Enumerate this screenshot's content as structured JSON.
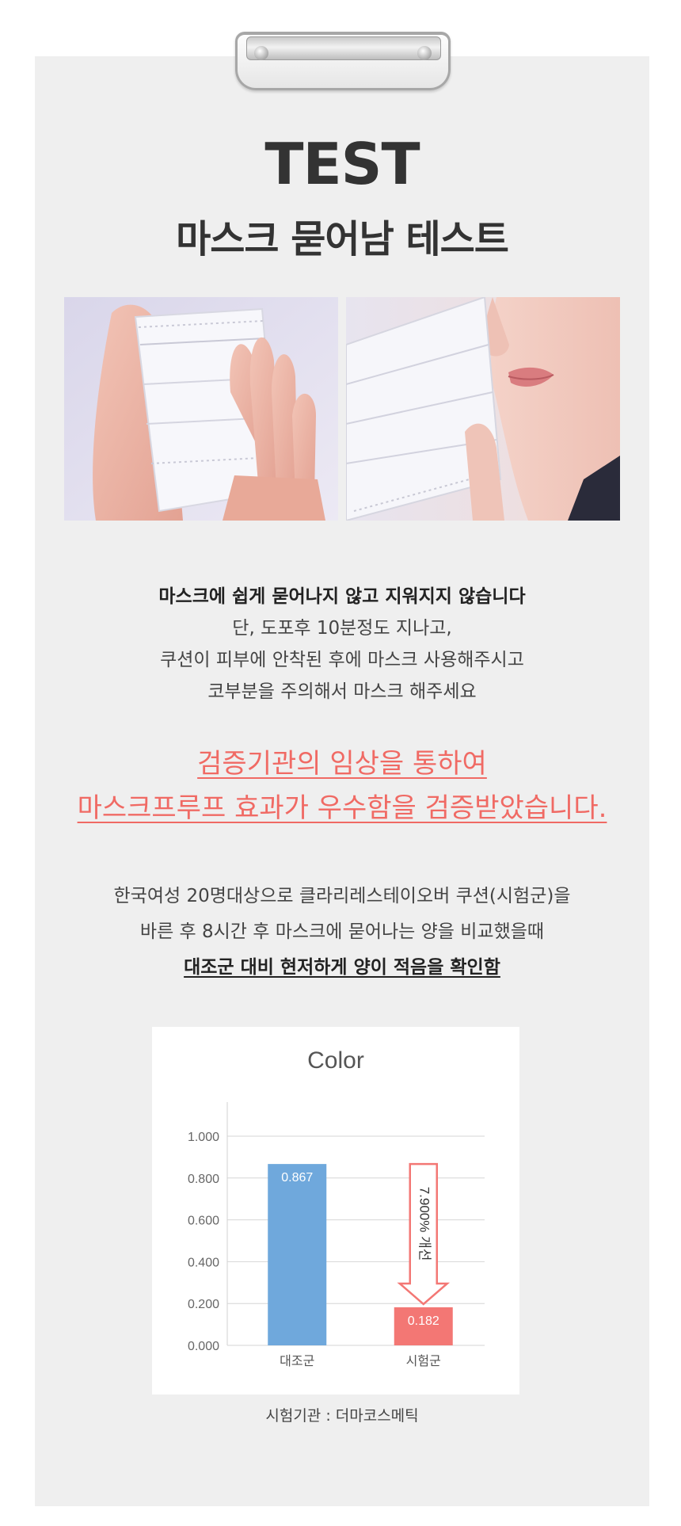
{
  "header": {
    "title_en": "TEST",
    "title_ko": "마스크 묻어남 테스트"
  },
  "photos": [
    {
      "icon": "hand-holding-mask-photo"
    },
    {
      "icon": "mask-near-face-photo"
    }
  ],
  "description": {
    "lead": "마스크에 쉽게 묻어나지 않고 지워지지 않습니다",
    "lines": [
      "단, 도포후 10분정도 지나고,",
      "쿠션이 피부에 안착된 후에 마스크 사용해주시고",
      "코부분을 주의해서 마스크 해주세요"
    ]
  },
  "headline": {
    "line1": "검증기관의 임상을 통하여",
    "line2": "마스크프루프 효과가 우수함을 검증받았습니다.",
    "color": "#f06a64"
  },
  "study": {
    "line1": "한국여성 20명대상으로 클라리레스테이오버 쿠션(시험군)을",
    "line2": "바른 후 8시간 후 마스크에 묻어나는 양을 비교했을때",
    "line3": "대조군 대비 현저하게 양이 적음을 확인함"
  },
  "chart_data": {
    "type": "bar",
    "title": "Color",
    "categories": [
      "대조군",
      "시험군"
    ],
    "values": [
      0.867,
      0.182
    ],
    "value_labels": [
      "0.867",
      "0.182"
    ],
    "colors": [
      "#6fa8dc",
      "#f37774"
    ],
    "ylim": [
      0,
      1
    ],
    "yticks": [
      "0.000",
      "0.200",
      "0.400",
      "0.600",
      "0.800",
      "1.000"
    ],
    "ytick_values": [
      0,
      0.2,
      0.4,
      0.6,
      0.8,
      1.0
    ],
    "annotation": "7.900% 개선",
    "grid": true
  },
  "source": "시험기관 : 더마코스메틱"
}
